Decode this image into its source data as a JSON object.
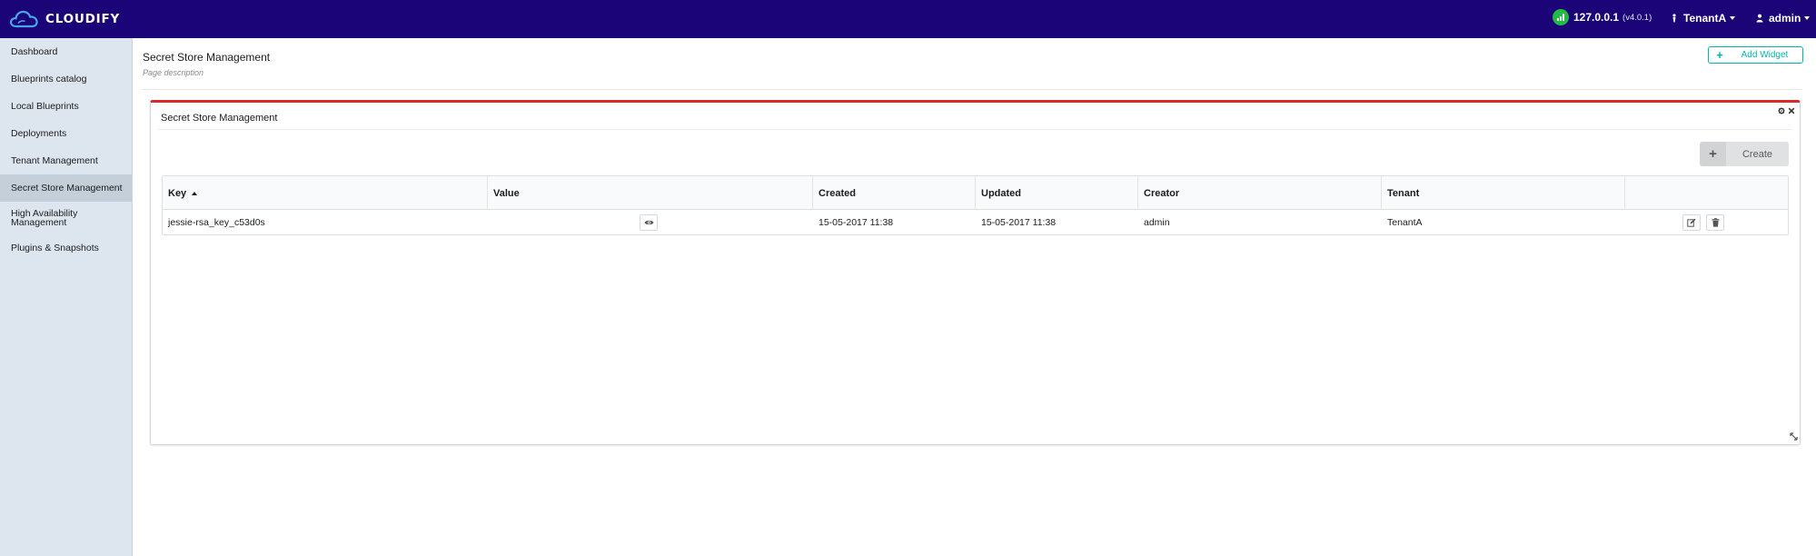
{
  "app": {
    "logo_text": "CLOUDIFY"
  },
  "header": {
    "manager_ip": "127.0.0.1",
    "manager_version": "(v4.0.1)",
    "tenant": "TenantA",
    "user": "admin"
  },
  "sidebar": {
    "items": [
      {
        "label": "Dashboard"
      },
      {
        "label": "Blueprints catalog"
      },
      {
        "label": "Local Blueprints"
      },
      {
        "label": "Deployments"
      },
      {
        "label": "Tenant Management"
      },
      {
        "label": "Secret Store Management",
        "active": true
      },
      {
        "label_line1": "High Availability",
        "label_line2": "Management"
      },
      {
        "label": "Plugins & Snapshots"
      }
    ]
  },
  "page": {
    "title": "Secret Store Management",
    "description": "Page description",
    "add_widget_label": "Add Widget"
  },
  "widget": {
    "title": "Secret Store Management",
    "create_label": "Create",
    "columns": [
      "Key",
      "Value",
      "Created",
      "Updated",
      "Creator",
      "Tenant"
    ],
    "rows": [
      {
        "key": "jessie-rsa_key_c53d0s",
        "value": "",
        "created": "15-05-2017 11:38",
        "updated": "15-05-2017 11:38",
        "creator": "admin",
        "tenant": "TenantA"
      }
    ]
  },
  "colors": {
    "topbar": "#1a0478",
    "widget_accent": "#db2828",
    "teal": "#00b5ad",
    "status_green": "#21ba45",
    "sidebar": "#dde6ee"
  },
  "icons": [
    "cloud-logo-icon",
    "signal-icon",
    "user-tie-icon",
    "user-icon",
    "sort-ascending-icon",
    "eye-icon",
    "edit-icon",
    "trash-icon",
    "gear-icon",
    "close-icon",
    "resize-icon"
  ]
}
